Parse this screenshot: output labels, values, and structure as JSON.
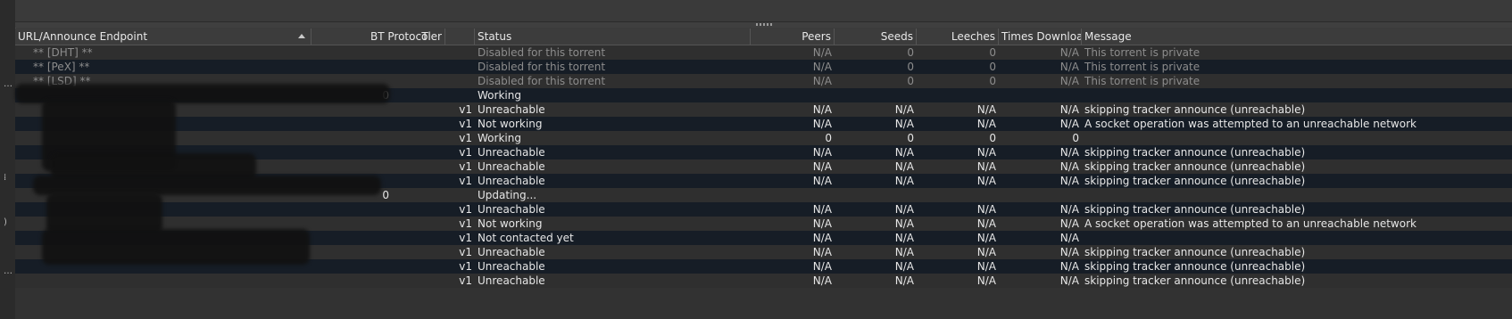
{
  "columns": {
    "url": "URL/Announce Endpoint",
    "tier": "Tier",
    "bt": "BT Protocol",
    "status": "Status",
    "peers": "Peers",
    "seeds": "Seeds",
    "leeches": "Leeches",
    "downloaded": "Times Downloa...",
    "message": "Message"
  },
  "rows": [
    {
      "url": "** [DHT] **",
      "tier": "",
      "bt": "",
      "status": "Disabled for this torrent",
      "peers": "N/A",
      "seeds": "0",
      "leeches": "0",
      "downloaded": "N/A",
      "message": "This torrent is private",
      "dim": true
    },
    {
      "url": "** [PeX] **",
      "tier": "",
      "bt": "",
      "status": "Disabled for this torrent",
      "peers": "N/A",
      "seeds": "0",
      "leeches": "0",
      "downloaded": "N/A",
      "message": "This torrent is private",
      "dim": true
    },
    {
      "url": "** [LSD] **",
      "tier": "",
      "bt": "",
      "status": "Disabled for this torrent",
      "peers": "N/A",
      "seeds": "0",
      "leeches": "0",
      "downloaded": "N/A",
      "message": "This torrent is private",
      "dim": true
    },
    {
      "url": "",
      "tier": "0",
      "bt": "",
      "status": "Working",
      "peers": "",
      "seeds": "",
      "leeches": "",
      "downloaded": "",
      "message": ""
    },
    {
      "url": "",
      "tier": "",
      "bt": "v1",
      "status": "Unreachable",
      "peers": "N/A",
      "seeds": "N/A",
      "leeches": "N/A",
      "downloaded": "N/A",
      "message": "skipping tracker announce (unreachable)"
    },
    {
      "url": "",
      "tier": "",
      "bt": "v1",
      "status": "Not working",
      "peers": "N/A",
      "seeds": "N/A",
      "leeches": "N/A",
      "downloaded": "N/A",
      "message": "A socket operation was attempted to an unreachable network"
    },
    {
      "url": "",
      "tier": "",
      "bt": "v1",
      "status": "Working",
      "peers": "0",
      "seeds": "0",
      "leeches": "0",
      "downloaded": "0",
      "message": ""
    },
    {
      "url": "",
      "tier": "",
      "bt": "v1",
      "status": "Unreachable",
      "peers": "N/A",
      "seeds": "N/A",
      "leeches": "N/A",
      "downloaded": "N/A",
      "message": "skipping tracker announce (unreachable)"
    },
    {
      "url": "",
      "tier": "",
      "bt": "v1",
      "status": "Unreachable",
      "peers": "N/A",
      "seeds": "N/A",
      "leeches": "N/A",
      "downloaded": "N/A",
      "message": "skipping tracker announce (unreachable)"
    },
    {
      "url": "",
      "tier": "",
      "bt": "v1",
      "status": "Unreachable",
      "peers": "N/A",
      "seeds": "N/A",
      "leeches": "N/A",
      "downloaded": "N/A",
      "message": "skipping tracker announce (unreachable)"
    },
    {
      "url": "",
      "tier": "0",
      "bt": "",
      "status": "Updating...",
      "peers": "",
      "seeds": "",
      "leeches": "",
      "downloaded": "",
      "message": ""
    },
    {
      "url": "",
      "tier": "",
      "bt": "v1",
      "status": "Unreachable",
      "peers": "N/A",
      "seeds": "N/A",
      "leeches": "N/A",
      "downloaded": "N/A",
      "message": "skipping tracker announce (unreachable)"
    },
    {
      "url": "",
      "tier": "",
      "bt": "v1",
      "status": "Not working",
      "peers": "N/A",
      "seeds": "N/A",
      "leeches": "N/A",
      "downloaded": "N/A",
      "message": "A socket operation was attempted to an unreachable network"
    },
    {
      "url": "",
      "tier": "",
      "bt": "v1",
      "status": "Not contacted yet",
      "peers": "N/A",
      "seeds": "N/A",
      "leeches": "N/A",
      "downloaded": "N/A",
      "message": ""
    },
    {
      "url": "",
      "tier": "",
      "bt": "v1",
      "status": "Unreachable",
      "peers": "N/A",
      "seeds": "N/A",
      "leeches": "N/A",
      "downloaded": "N/A",
      "message": "skipping tracker announce (unreachable)"
    },
    {
      "url": "",
      "tier": "",
      "bt": "v1",
      "status": "Unreachable",
      "peers": "N/A",
      "seeds": "N/A",
      "leeches": "N/A",
      "downloaded": "N/A",
      "message": "skipping tracker announce (unreachable)"
    },
    {
      "url": "",
      "tier": "",
      "bt": "v1",
      "status": "Unreachable",
      "peers": "N/A",
      "seeds": "N/A",
      "leeches": "N/A",
      "downloaded": "N/A",
      "message": "skipping tracker announce (unreachable)"
    }
  ]
}
